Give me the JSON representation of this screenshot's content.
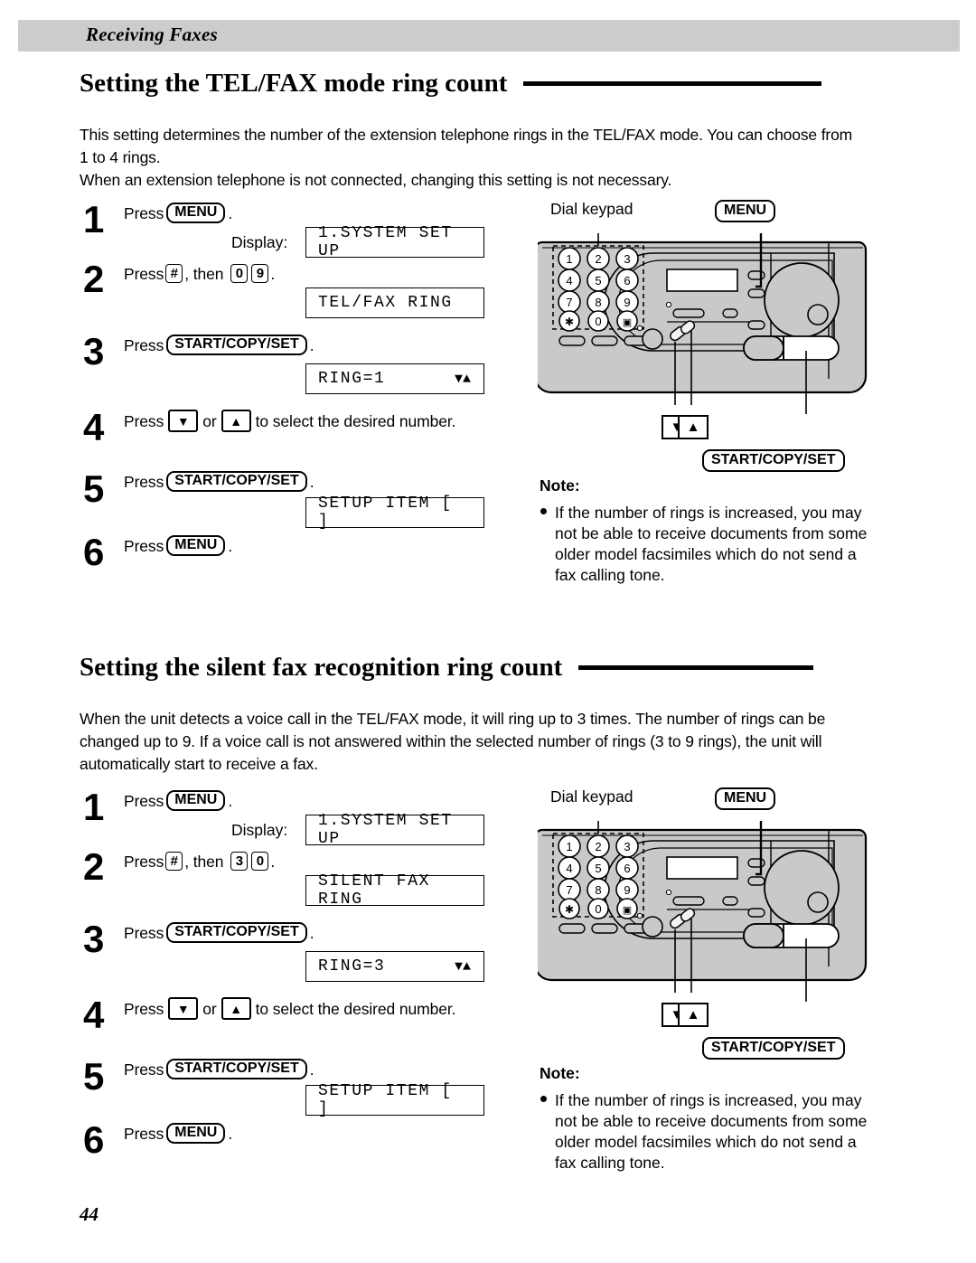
{
  "header": {
    "running_head": "Receiving Faxes"
  },
  "page": {
    "number": "44"
  },
  "sections": [
    {
      "heading": "Setting the TEL/FAX mode ring count",
      "intro": "This setting determines the number of the extension telephone rings in the TEL/FAX mode. You can choose from 1 to 4 rings.\nWhen an extension telephone is not connected, changing this setting is not necessary.",
      "steps": [
        {
          "num": "1",
          "press": "Press",
          "key": "MENU",
          "period": "."
        },
        {
          "num": "2",
          "press": "Press",
          "key": "#",
          "then": ", then",
          "digits": [
            "0",
            "9"
          ],
          "period": "."
        },
        {
          "num": "3",
          "press": "Press",
          "key": "START/COPY/SET",
          "period": "."
        },
        {
          "num": "4",
          "press": "Press",
          "down": "▼",
          "or": "or",
          "up": "▲",
          "tail": "to select the desired number."
        },
        {
          "num": "5",
          "press": "Press",
          "key": "START/COPY/SET",
          "period": "."
        },
        {
          "num": "6",
          "press": "Press",
          "key": "MENU",
          "period": "."
        }
      ],
      "display_label": "Display:",
      "displays": [
        {
          "text": "1.SYSTEM SET UP",
          "arrows": ""
        },
        {
          "text": "TEL/FAX RING",
          "arrows": ""
        },
        {
          "text": "RING=1",
          "arrows": "▼▲"
        },
        {
          "text": "SETUP ITEM [   ]",
          "arrows": ""
        }
      ],
      "note": {
        "title": "Note:",
        "body": "If the number of rings is increased, you may not be able to receive documents from some older model facsimiles which do not send a fax calling tone."
      },
      "diagram": {
        "dial_keypad_label": "Dial keypad",
        "menu_callout": "MENU",
        "start_callout": "START/COPY/SET",
        "down_arrow": "▼",
        "up_arrow": "▲",
        "keypad_keys": [
          "1",
          "2",
          "3",
          "4",
          "5",
          "6",
          "7",
          "8",
          "9",
          "✳",
          "0",
          "▣"
        ]
      }
    },
    {
      "heading": "Setting the silent fax recognition ring count",
      "intro": "When the unit detects a voice call in the TEL/FAX mode, it will ring up to 3 times. The number of rings can be changed up to 9. If a voice call is not answered within the selected number of rings (3 to 9 rings), the unit will automatically start to receive a fax.",
      "steps": [
        {
          "num": "1",
          "press": "Press",
          "key": "MENU",
          "period": "."
        },
        {
          "num": "2",
          "press": "Press",
          "key": "#",
          "then": ", then",
          "digits": [
            "3",
            "0"
          ],
          "period": "."
        },
        {
          "num": "3",
          "press": "Press",
          "key": "START/COPY/SET",
          "period": "."
        },
        {
          "num": "4",
          "press": "Press",
          "down": "▼",
          "or": "or",
          "up": "▲",
          "tail": "to select the desired number."
        },
        {
          "num": "5",
          "press": "Press",
          "key": "START/COPY/SET",
          "period": "."
        },
        {
          "num": "6",
          "press": "Press",
          "key": "MENU",
          "period": "."
        }
      ],
      "display_label": "Display:",
      "displays": [
        {
          "text": "1.SYSTEM SET UP",
          "arrows": ""
        },
        {
          "text": "SILENT FAX RING",
          "arrows": ""
        },
        {
          "text": "RING=3",
          "arrows": "▼▲"
        },
        {
          "text": "SETUP ITEM [   ]",
          "arrows": ""
        }
      ],
      "note": {
        "title": "Note:",
        "body": "If the number of rings is increased, you may not be able to receive documents from some older model facsimiles which do not send a fax calling tone."
      },
      "diagram": {
        "dial_keypad_label": "Dial keypad",
        "menu_callout": "MENU",
        "start_callout": "START/COPY/SET",
        "down_arrow": "▼",
        "up_arrow": "▲",
        "keypad_keys": [
          "1",
          "2",
          "3",
          "4",
          "5",
          "6",
          "7",
          "8",
          "9",
          "✳",
          "0",
          "▣"
        ]
      }
    }
  ],
  "colors": {
    "band": "#cccccc",
    "body": "#c9c9c9",
    "ink": "#000000"
  }
}
